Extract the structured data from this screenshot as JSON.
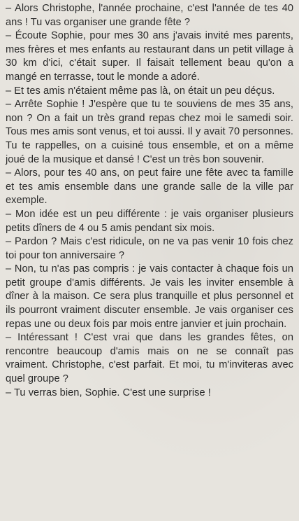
{
  "dialogue": [
    "– Alors Christophe, l'année prochaine, c'est l'année de tes 40 ans ! Tu vas organiser une grande fête ?",
    "– Écoute Sophie, pour mes 30 ans j'avais invité mes parents, mes frères et mes enfants au restaurant dans un petit village à 30 km d'ici, c'était super. Il faisait tellement beau qu'on a mangé en terrasse, tout le monde a adoré.",
    "– Et tes amis n'étaient même pas là, on était un peu déçus.",
    "– Arrête Sophie ! J'espère que tu te souviens de mes 35 ans, non ? On a fait un très grand repas chez moi le samedi soir. Tous mes amis sont venus, et toi aussi. Il y avait 70 personnes. Tu te rappelles, on a cuisiné tous ensemble, et on a même joué de la musique et dansé ! C'est un très bon souvenir.",
    "– Alors, pour tes 40 ans, on peut faire une fête avec ta famille et tes amis ensemble dans une grande salle de la ville par exemple.",
    "– Mon idée est un peu différente : je vais organiser plusieurs petits dîners de 4 ou 5 amis pendant six mois.",
    "– Pardon ? Mais c'est ridicule, on ne va pas venir 10 fois chez toi pour ton anniversaire ?",
    "– Non, tu n'as pas compris : je vais contacter à chaque fois un petit groupe d'amis différents. Je vais les inviter ensemble à dîner à la maison. Ce sera plus tranquille et plus personnel et ils pourront vraiment discuter ensemble. Je vais organiser ces repas une ou deux fois par mois entre janvier et juin prochain.",
    "– Intéressant ! C'est vrai que dans les grandes fêtes, on rencontre beaucoup d'amis mais on ne se connaît pas vraiment. Christophe, c'est parfait. Et moi, tu m'inviteras avec quel groupe ?",
    "– Tu verras bien, Sophie. C'est une surprise !"
  ]
}
